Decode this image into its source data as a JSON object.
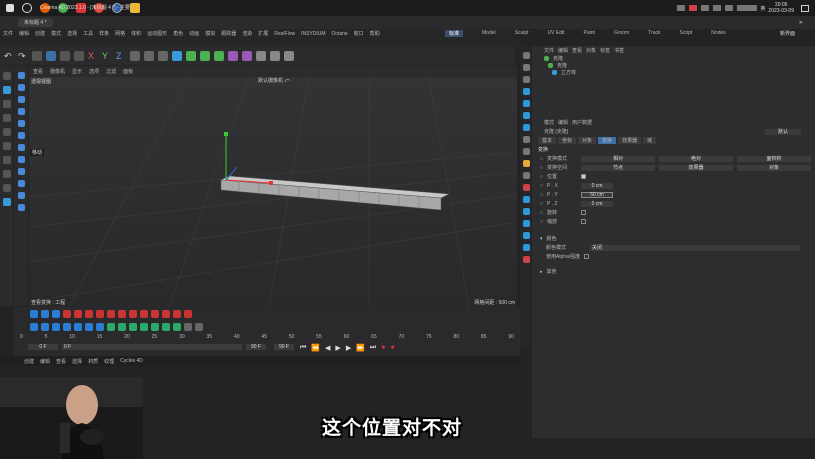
{
  "taskbar": {
    "time": "20:05",
    "date": "2023-03-09",
    "ime": "英"
  },
  "window": {
    "title": "Cinema 4D 2023.1.0 - [未标题 4 *] - 主要",
    "tab": "未标题 4 *"
  },
  "menu": [
    "文件",
    "编辑",
    "创建",
    "模式",
    "选择",
    "工具",
    "样条",
    "网格",
    "体积",
    "运动图形",
    "角色",
    "动画",
    "模拟",
    "跟踪器",
    "渲染",
    "扩展",
    "RealFlow",
    "INSYDIUM",
    "Octane",
    "窗口",
    "帮助"
  ],
  "modes": [
    "标准",
    "Model",
    "Sculpt",
    "UV Edit",
    "Paint",
    "Groom",
    "Track",
    "Script",
    "Nodes"
  ],
  "layout_label": "新界面",
  "viewport": {
    "menus": [
      "查看",
      "摄像机",
      "显示",
      "选项",
      "过滤",
      "面板"
    ],
    "name": "透视视图",
    "camera": "默认摄像机 ⤺",
    "grid_info": "网格间距 : 500 cm",
    "move_label": "移动"
  },
  "status": [
    "查看变换 : 工程"
  ],
  "timeline": {
    "ticks": [
      "0",
      "5",
      "10",
      "15",
      "20",
      "25",
      "30",
      "35",
      "40",
      "45",
      "50",
      "55",
      "60",
      "65",
      "70",
      "75",
      "80",
      "85",
      "90"
    ],
    "start": "0 F",
    "current": "0 F",
    "end": "90 F",
    "end2": "90 F"
  },
  "bottom_menu": [
    "创建",
    "编辑",
    "查看",
    "选择",
    "材质",
    "纹理",
    "Cycles 4D"
  ],
  "objects": {
    "menus": [
      "文件",
      "编辑",
      "查看",
      "对象",
      "标签",
      "书签"
    ],
    "items": [
      "克隆",
      "克隆",
      "立方体"
    ]
  },
  "attributes": {
    "menus": [
      "模式",
      "编辑",
      "用户数据"
    ],
    "object_name": "克隆 [克隆]",
    "preset": "默认",
    "tabs": [
      "基本",
      "坐标",
      "对象",
      "变换",
      "效果器",
      "域"
    ],
    "section": "变换",
    "params": [
      {
        "label": "变换模式",
        "v1": "相对",
        "v2": "绝对",
        "v3": "面积积"
      },
      {
        "label": "变换空间",
        "v1": "节点",
        "v2": "效果器",
        "v3": "对象"
      },
      {
        "label": "位置",
        "v1": "",
        "v2": "",
        "v3": ""
      },
      {
        "label": "P . X",
        "v1": "0 cm"
      },
      {
        "label": "P . Y",
        "v1": "50 cm"
      },
      {
        "label": "P . Z",
        "v1": "0 cm"
      },
      {
        "label": "旋转"
      },
      {
        "label": "缩放"
      }
    ],
    "color_section": "颜色",
    "color_mode_label": "颜色模式",
    "color_mode_value": "关闭",
    "use_alpha": "使用Alpha/强度",
    "other_section": "其他"
  },
  "subtitle": "这个位置对不对"
}
